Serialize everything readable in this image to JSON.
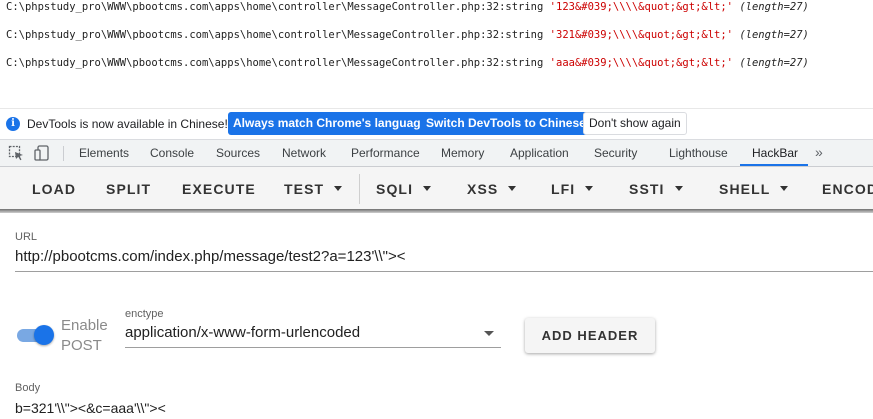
{
  "output": {
    "lines": [
      {
        "path": "C:\\phpstudy_pro\\WWW\\pbootcms.com\\apps\\home\\controller\\MessageController.php:32:string",
        "value": "'123&#039;\\\\\\\\&quot;&gt;&lt;'",
        "length": "(length=27)"
      },
      {
        "path": "C:\\phpstudy_pro\\WWW\\pbootcms.com\\apps\\home\\controller\\MessageController.php:32:string",
        "value": "'321&#039;\\\\\\\\&quot;&gt;&lt;'",
        "length": "(length=27)"
      },
      {
        "path": "C:\\phpstudy_pro\\WWW\\pbootcms.com\\apps\\home\\controller\\MessageController.php:32:string",
        "value": "'aaa&#039;\\\\\\\\&quot;&gt;&lt;'",
        "length": "(length=27)"
      }
    ]
  },
  "infobar": {
    "icon": "info-icon",
    "message": "DevTools is now available in Chinese!",
    "btn_match": "Always match Chrome's language",
    "btn_switch": "Switch DevTools to Chinese",
    "btn_dismiss": "Don't show again"
  },
  "devtools": {
    "tabs": [
      "Elements",
      "Console",
      "Sources",
      "Network",
      "Performance",
      "Memory",
      "Application",
      "Security",
      "Lighthouse",
      "HackBar"
    ],
    "active_tab": "HackBar",
    "more": "»"
  },
  "hackbar": {
    "toolbar": {
      "load": "LOAD",
      "split": "SPLIT",
      "execute": "EXECUTE",
      "test": "TEST",
      "sqli": "SQLI",
      "xss": "XSS",
      "lfi": "LFI",
      "ssti": "SSTI",
      "shell": "SHELL",
      "encode": "ENCODING"
    },
    "url": {
      "label": "URL",
      "value": "http://pbootcms.com/index.php/message/test2?a=123'\\\\\"><"
    },
    "post": {
      "label_line1": "Enable",
      "label_line2": "POST",
      "enabled": true
    },
    "enctype": {
      "label": "enctype",
      "value": "application/x-www-form-urlencoded"
    },
    "add_header": "ADD HEADER",
    "body": {
      "label": "Body",
      "value": "b=321'\\\\\"><&c=aaa'\\\\\"><"
    }
  },
  "colors": {
    "accent": "#1a73e8",
    "string_value": "#cc0000",
    "toolbar_bg": "#f5f5f5"
  }
}
